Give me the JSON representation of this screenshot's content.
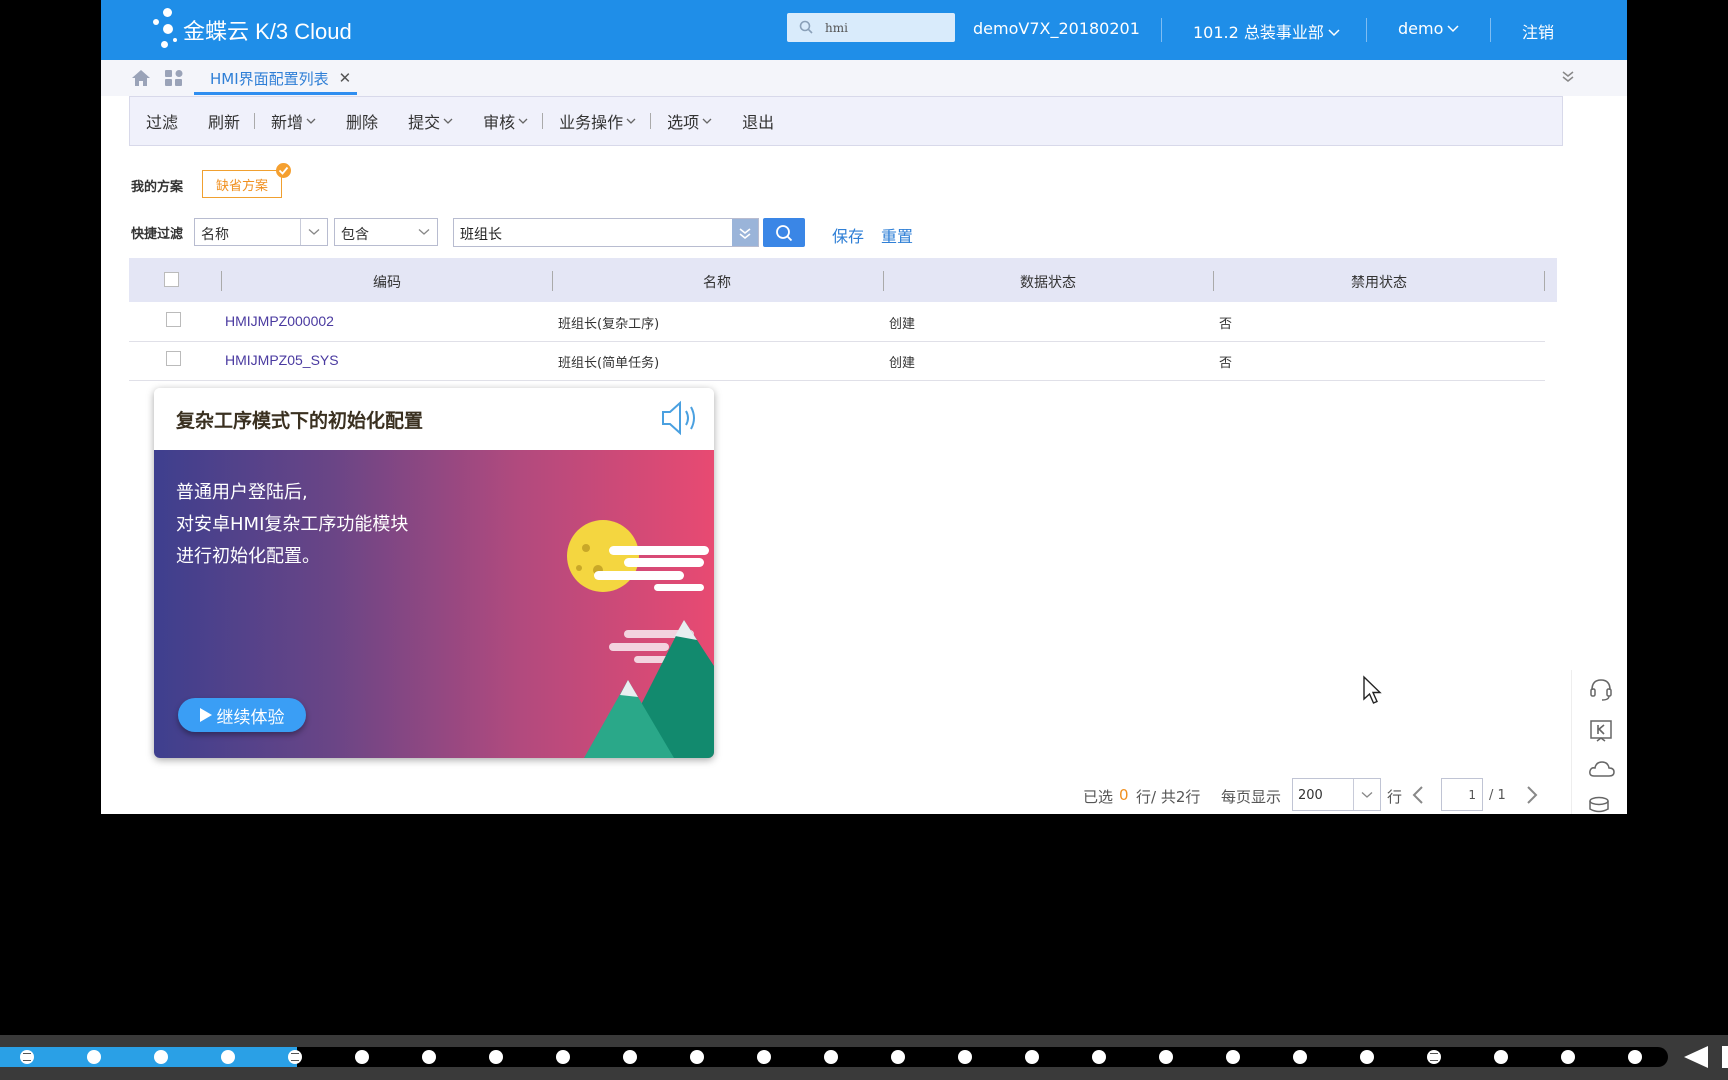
{
  "header": {
    "logo_text": "金蝶云 K/3 Cloud",
    "search_value": "hmi",
    "database": "demoV7X_20180201",
    "org": "101.2 总装事业部",
    "user": "demo",
    "logout": "注销"
  },
  "tabs": [
    {
      "label": "HMI界面配置列表",
      "active": true
    }
  ],
  "toolbar": {
    "items": [
      "过滤",
      "刷新",
      "新增",
      "删除",
      "提交",
      "审核",
      "业务操作",
      "选项",
      "退出"
    ]
  },
  "scheme": {
    "label": "我的方案",
    "default_button": "缺省方案"
  },
  "quick_filter": {
    "label": "快捷过滤",
    "field": "名称",
    "operator": "包含",
    "value": "班组长",
    "save": "保存",
    "reset": "重置"
  },
  "table": {
    "columns": [
      "编码",
      "名称",
      "数据状态",
      "禁用状态"
    ],
    "rows": [
      {
        "code": "HMIJMPZ000002",
        "name": "班组长(复杂工序)",
        "status": "创建",
        "disabled": "否"
      },
      {
        "code": "HMIJMPZ05_SYS",
        "name": "班组长(简单任务)",
        "status": "创建",
        "disabled": "否"
      }
    ]
  },
  "guide_card": {
    "title": "复杂工序模式下的初始化配置",
    "lines": [
      "普通用户登陆后,",
      "对安卓HMI复杂工序功能模块",
      "进行初始化配置。"
    ],
    "button": "继续体验"
  },
  "pager": {
    "selected_prefix": "已选",
    "selected_count": "0",
    "selected_suffix": "行/ 共2行",
    "per_page_label": "每页显示",
    "per_page": "200",
    "row_unit": "行",
    "current_page": "1",
    "total_pages": "/ 1"
  },
  "colors": {
    "header": "#1f8ee8",
    "accent": "#2f7fd6",
    "scheme_orange": "#f09020",
    "progress": "#2aa0e6"
  },
  "player": {
    "progress": 0.178,
    "markers": 25
  },
  "icons": [
    "search-icon",
    "home-icon",
    "apps-icon",
    "close-icon",
    "chevron-down-icon",
    "check-icon",
    "speaker-icon",
    "play-icon",
    "headset-icon",
    "k-icon",
    "cloud-icon",
    "database-icon",
    "cursor-icon"
  ]
}
